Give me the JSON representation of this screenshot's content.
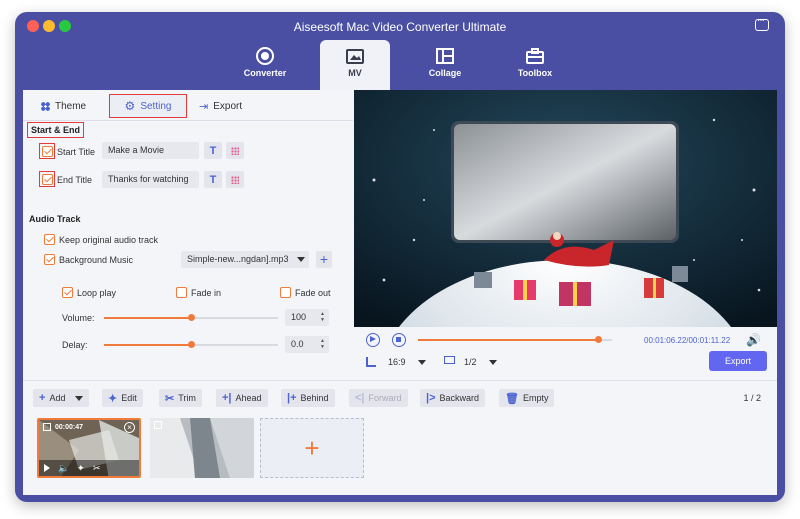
{
  "window": {
    "title": "Aiseesoft Mac Video Converter Ultimate"
  },
  "nav": {
    "tabs": [
      {
        "id": "converter",
        "label": "Converter",
        "icon": "converter-icon"
      },
      {
        "id": "mv",
        "label": "MV",
        "icon": "mv-icon",
        "active": true
      },
      {
        "id": "collage",
        "label": "Collage",
        "icon": "collage-icon"
      },
      {
        "id": "toolbox",
        "label": "Toolbox",
        "icon": "toolbox-icon"
      }
    ]
  },
  "left_tabs": {
    "theme": "Theme",
    "setting": "Setting",
    "export": "Export"
  },
  "start_end": {
    "header": "Start & End",
    "start_title": {
      "label": "Start Title",
      "value": "Make a Movie",
      "checked": true
    },
    "end_title": {
      "label": "End Title",
      "value": "Thanks for watching",
      "checked": true
    }
  },
  "audio": {
    "header": "Audio Track",
    "keep_original": {
      "label": "Keep original audio track",
      "checked": true
    },
    "background_music": {
      "label": "Background Music",
      "checked": true,
      "file": "Simple-new...ngdan].mp3"
    },
    "loop_play": {
      "label": "Loop play",
      "checked": true
    },
    "fade_in": {
      "label": "Fade in",
      "checked": false
    },
    "fade_out": {
      "label": "Fade out",
      "checked": false
    },
    "volume": {
      "label": "Volume:",
      "value": "100",
      "level": 0.5
    },
    "delay": {
      "label": "Delay:",
      "value": "0.0",
      "level": 0.5
    }
  },
  "player": {
    "time": "00:01:06.22/00:01:11.22",
    "progress": 0.93,
    "aspect": "16:9",
    "scale": "1/2",
    "export_label": "Export"
  },
  "toolbar": {
    "add": "Add",
    "edit": "Edit",
    "trim": "Trim",
    "ahead": "Ahead",
    "behind": "Behind",
    "forward": "Forward",
    "backward": "Backward",
    "empty": "Empty",
    "pager": "1 / 2"
  },
  "clips": [
    {
      "timestamp": "00:00:47",
      "selected": true
    },
    {
      "selected": false
    }
  ],
  "colors": {
    "accent": "#f07a3a",
    "brand": "#4a4fa3",
    "button": "#6366f1",
    "highlight": "#e23b3b"
  }
}
